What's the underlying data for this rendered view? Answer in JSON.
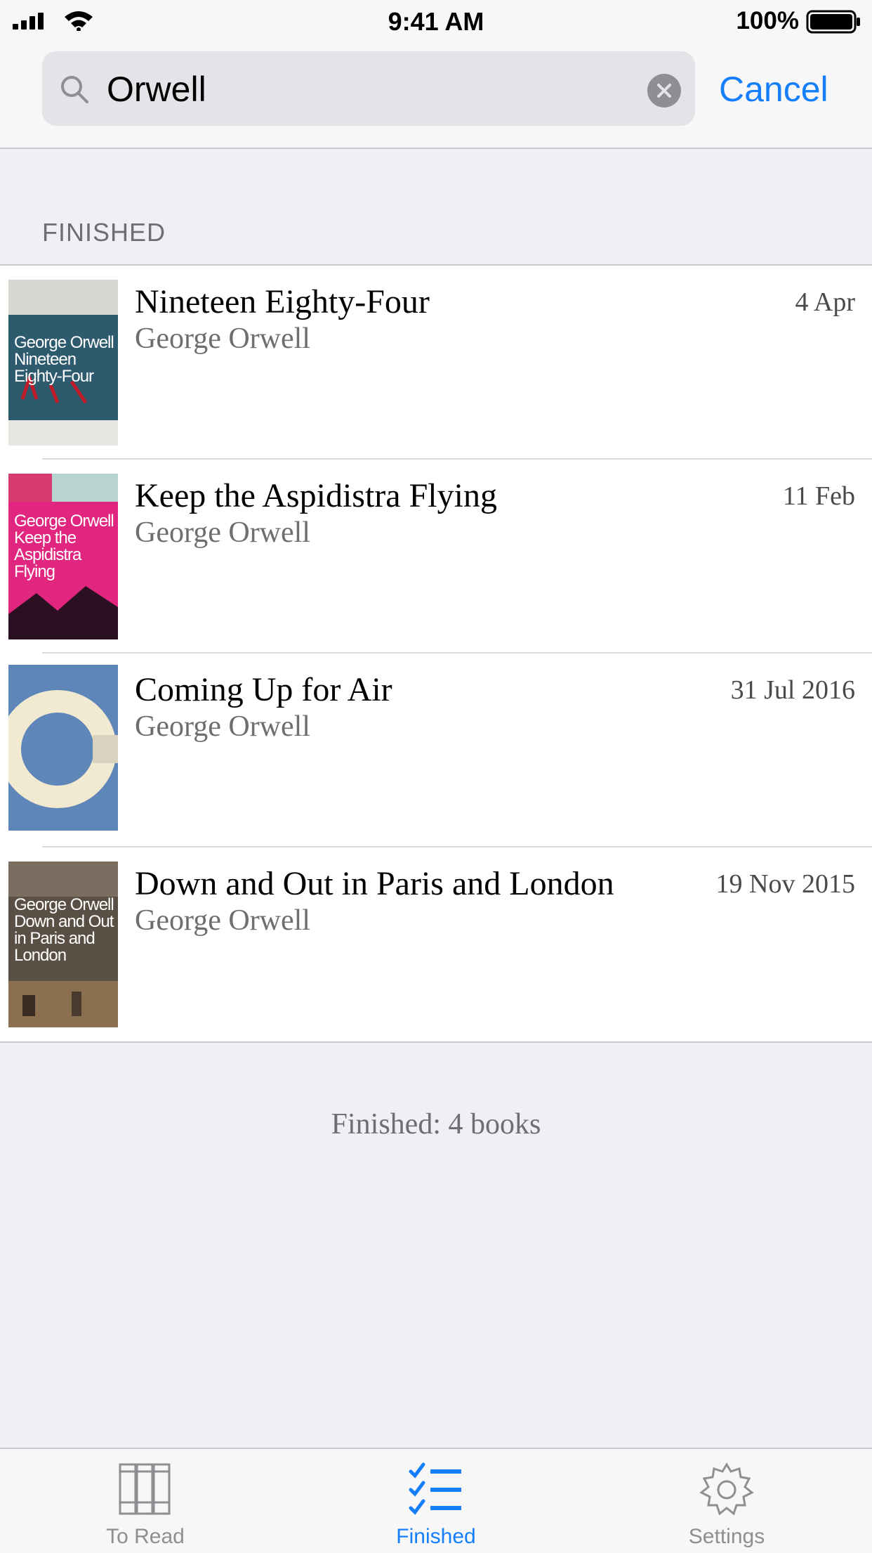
{
  "status_bar": {
    "time": "9:41 AM",
    "battery": "100%"
  },
  "search": {
    "value": "Orwell",
    "cancel_label": "Cancel"
  },
  "section": {
    "header": "FINISHED"
  },
  "books": [
    {
      "title": "Nineteen Eighty-Four",
      "author": "George Orwell",
      "date": "4 Apr",
      "cover_color": "#2e5a6e",
      "cover_text": "George Orwell Nineteen Eighty-Four"
    },
    {
      "title": "Keep the Aspidistra Flying",
      "author": "George Orwell",
      "date": "11 Feb",
      "cover_color": "#e0267e",
      "cover_text": "George Orwell Keep the Aspidistra Flying"
    },
    {
      "title": "Coming Up for Air",
      "author": "George Orwell",
      "date": "31 Jul 2016",
      "cover_color": "#5e86b8",
      "cover_text": ""
    },
    {
      "title": "Down and Out in Paris and London",
      "author": "George Orwell",
      "date": "19 Nov 2015",
      "cover_color": "#5a4f45",
      "cover_text": "George Orwell Down and Out in Paris and London"
    }
  ],
  "footer": {
    "count": "Finished: 4 books"
  },
  "tabs": [
    {
      "label": "To Read",
      "icon": "books-icon",
      "active": false
    },
    {
      "label": "Finished",
      "icon": "checklist-icon",
      "active": true
    },
    {
      "label": "Settings",
      "icon": "gear-icon",
      "active": false
    }
  ],
  "colors": {
    "accent": "#147efb",
    "background": "#efeff4",
    "secondary_text": "#6d6d72"
  }
}
